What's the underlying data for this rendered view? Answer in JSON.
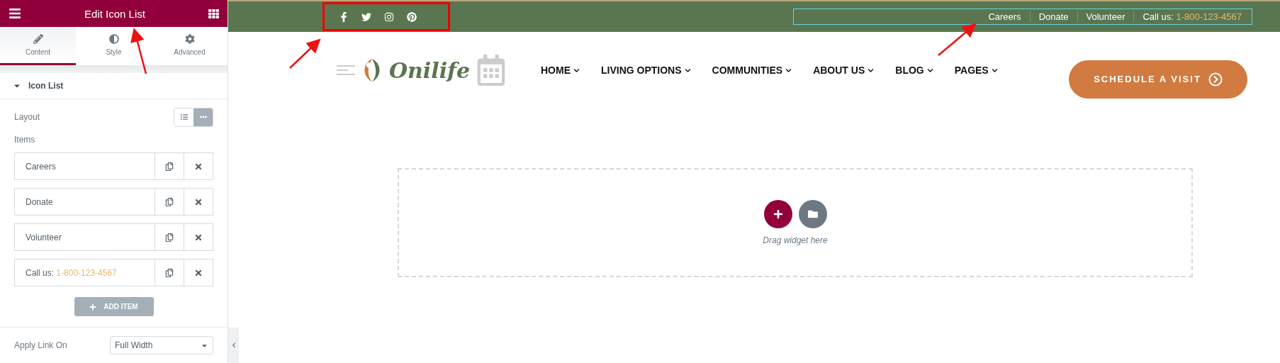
{
  "panel": {
    "title": "Edit Icon List",
    "tabs": [
      {
        "label": "Content",
        "kind": "pencil",
        "selected": true
      },
      {
        "label": "Style",
        "kind": "contrast",
        "selected": false
      },
      {
        "label": "Advanced",
        "kind": "gear",
        "selected": false
      }
    ],
    "section": {
      "title": "Icon List",
      "expanded": true
    },
    "layout": {
      "label": "Layout",
      "options": [
        {
          "kind": "list",
          "selected": false
        },
        {
          "kind": "inline",
          "selected": true
        }
      ]
    },
    "items_label": "Items",
    "items": [
      {
        "text": "Careers"
      },
      {
        "text": "Donate"
      },
      {
        "text": "Volunteer"
      },
      {
        "text": "Call us:",
        "highlight": "1-800-123-4567"
      }
    ],
    "add_button": "ADD ITEM",
    "link": {
      "label": "Apply Link On",
      "value": "Full Width"
    }
  },
  "site": {
    "social": [
      {
        "kind": "facebook"
      },
      {
        "kind": "twitter"
      },
      {
        "kind": "instagram"
      },
      {
        "kind": "pinterest"
      }
    ],
    "top_links": [
      {
        "text": "Careers"
      },
      {
        "text": "Donate"
      },
      {
        "text": "Volunteer"
      },
      {
        "text": "Call us:",
        "highlight": "1-800-123-4567"
      }
    ],
    "logo": "Onilife",
    "menu": [
      "HOME",
      "LIVING OPTIONS",
      "COMMUNITIES",
      "ABOUT US",
      "BLOG",
      "PAGES"
    ],
    "cta": "SCHEDULE A VISIT",
    "dropzone": "Drag widget here"
  }
}
